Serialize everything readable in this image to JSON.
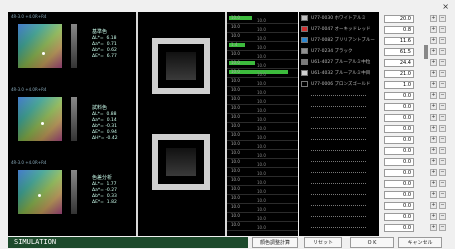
{
  "window": {
    "close": "×"
  },
  "left_panel": {
    "blocks": [
      {
        "ticks": "4R-3.0        +4.0R+R4",
        "title": "基準色",
        "readout": "ΔL*=  6.18\nΔa*=  0.71\nΔb*=  0.62\nΔE*=  6.77"
      },
      {
        "ticks": "4R-3.0        +4.0R+R4",
        "title": "試料色",
        "readout": "ΔL*=  0.88\nΔa*=  0.14\nΔb*= -0.31\nΔE*=  0.94\nΔH*= -0.42"
      },
      {
        "ticks": "4R-3.0        +4.0R+R4",
        "title": "色差分析",
        "readout": "ΔL*=  1.77\nΔa*= -0.27\nΔb*=  0.33\nΔE*=  1.82"
      }
    ]
  },
  "spectrum_rows": [
    {
      "v1": "10.0",
      "v2": "10.0",
      "bar": 0.35
    },
    {
      "v1": "10.0",
      "v2": "10.0",
      "bar": 0
    },
    {
      "v1": "10.0",
      "v2": "10.0",
      "bar": 0
    },
    {
      "v1": "1.4",
      "v2": "10.0",
      "bar": 0.25
    },
    {
      "v1": "10.0",
      "v2": "10.0",
      "bar": 0
    },
    {
      "v1": "10.0",
      "v2": "10.0",
      "bar": 0.4
    },
    {
      "v1": "10.0",
      "v2": "10.0",
      "bar": 0.9
    },
    {
      "v1": "10.0",
      "v2": "10.0",
      "bar": 0
    },
    {
      "v1": "10.0",
      "v2": "10.0",
      "bar": 0
    },
    {
      "v1": "10.0",
      "v2": "10.0",
      "bar": 0
    },
    {
      "v1": "10.0",
      "v2": "10.0",
      "bar": 0
    },
    {
      "v1": "10.0",
      "v2": "10.0",
      "bar": 0
    },
    {
      "v1": "10.0",
      "v2": "10.0",
      "bar": 0
    },
    {
      "v1": "10.0",
      "v2": "10.0",
      "bar": 0
    },
    {
      "v1": "10.0",
      "v2": "10.0",
      "bar": 0
    },
    {
      "v1": "10.0",
      "v2": "10.0",
      "bar": 0
    },
    {
      "v1": "10.0",
      "v2": "10.0",
      "bar": 0
    },
    {
      "v1": "10.0",
      "v2": "10.0",
      "bar": 0
    },
    {
      "v1": "10.0",
      "v2": "10.0",
      "bar": 0
    },
    {
      "v1": "10.0",
      "v2": "10.0",
      "bar": 0
    },
    {
      "v1": "10.0",
      "v2": "10.0",
      "bar": 0
    },
    {
      "v1": "10.0",
      "v2": "10.0",
      "bar": 0
    },
    {
      "v1": "10.0",
      "v2": "10.0",
      "bar": 0
    },
    {
      "v1": "10.0",
      "v2": "10.0",
      "bar": 0
    }
  ],
  "colorants": [
    {
      "name": "U77-0030 ホワイトアルミ",
      "swatch": "#bfbfbf",
      "value": "20.0"
    },
    {
      "name": "U77-0047 オーキッドレッド",
      "swatch": "#d03030",
      "value": "0.8"
    },
    {
      "name": "U77-0082 ブリリアントブルー",
      "swatch": "#2a86d0",
      "value": "11.6"
    },
    {
      "name": "U77-0234 ブラック",
      "swatch": "#909090",
      "value": "61.5"
    },
    {
      "name": "U61-4027 ブルーアルミ中粒",
      "swatch": "#7a7a7a",
      "value": "24.4"
    },
    {
      "name": "U61-4032 ブルーアルミ中目",
      "swatch": "#cfcfcf",
      "value": "21.0"
    },
    {
      "name": "U77-0006 ブロンズゴールド",
      "swatch": "#000000",
      "value": "1.0"
    },
    {
      "name": "",
      "swatch": "",
      "value": "0.0"
    },
    {
      "name": "",
      "swatch": "",
      "value": "0.0"
    },
    {
      "name": "",
      "swatch": "",
      "value": "0.0"
    },
    {
      "name": "",
      "swatch": "",
      "value": "0.0"
    },
    {
      "name": "",
      "swatch": "",
      "value": "0.0"
    },
    {
      "name": "",
      "swatch": "",
      "value": "0.0"
    },
    {
      "name": "",
      "swatch": "",
      "value": "0.0"
    },
    {
      "name": "",
      "swatch": "",
      "value": "0.0"
    },
    {
      "name": "",
      "swatch": "",
      "value": "0.0"
    },
    {
      "name": "",
      "swatch": "",
      "value": "0.0"
    },
    {
      "name": "",
      "swatch": "",
      "value": "0.0"
    },
    {
      "name": "",
      "swatch": "",
      "value": "0.0"
    },
    {
      "name": "",
      "swatch": "",
      "value": "0.0"
    }
  ],
  "status": {
    "text": "SIMULATION"
  },
  "buttons": {
    "calc": "顔色調整計算",
    "reset": "リセット",
    "ok": "O K",
    "cancel": "キャンセル"
  },
  "icons": {
    "plus": "+",
    "minus": "−"
  }
}
